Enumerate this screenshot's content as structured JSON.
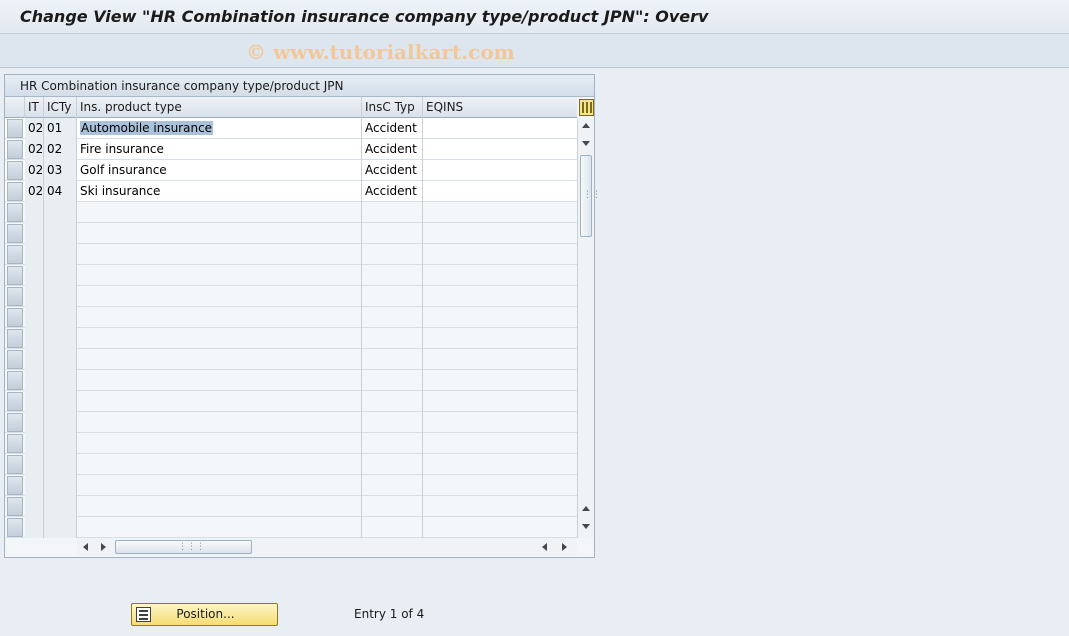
{
  "window": {
    "title": "Change View \"HR Combination insurance company type/product JPN\": Overv",
    "watermark": "© www.tutorialkart.com"
  },
  "table": {
    "title": "HR Combination insurance company type/product JPN",
    "columns": [
      "IT",
      "ICTy",
      "Ins. product type",
      "InsC Typ",
      "EQINS"
    ],
    "rows": [
      {
        "it": "02",
        "icty": "01",
        "product": "Automobile insurance",
        "insc_typ": "Accident",
        "eqins": ""
      },
      {
        "it": "02",
        "icty": "02",
        "product": "Fire insurance",
        "insc_typ": "Accident",
        "eqins": ""
      },
      {
        "it": "02",
        "icty": "03",
        "product": "Golf insurance",
        "insc_typ": "Accident",
        "eqins": ""
      },
      {
        "it": "02",
        "icty": "04",
        "product": "Ski insurance",
        "insc_typ": "Accident",
        "eqins": ""
      }
    ],
    "selected_row": 0
  },
  "footer": {
    "position_button": "Position...",
    "entry_status": "Entry 1 of 4"
  },
  "icons": {
    "column_config": "column-config-icon",
    "position": "position-list-icon"
  },
  "colors": {
    "button_fill": "#f6dc72",
    "selection": "#a9c1d9",
    "watermark": "#f2c79a"
  }
}
